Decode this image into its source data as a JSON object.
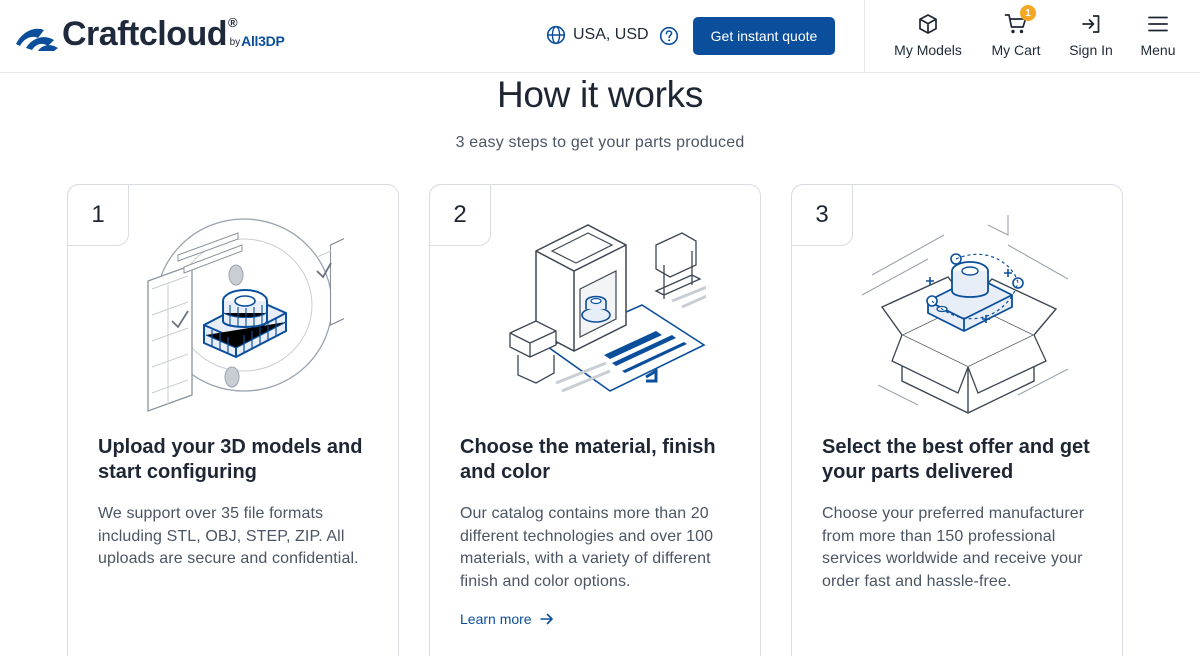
{
  "header": {
    "logo": {
      "name": "Craftcloud",
      "registered": "®",
      "by": "by",
      "partner": "All3DP"
    },
    "locale": {
      "label": "USA, USD",
      "icon": "globe-icon"
    },
    "help_icon": "question-circle-icon",
    "quote_button": "Get instant quote",
    "nav": [
      {
        "label": "My Models",
        "icon": "cube-icon"
      },
      {
        "label": "My Cart",
        "icon": "cart-icon",
        "badge": "1"
      },
      {
        "label": "Sign In",
        "icon": "sign-in-icon"
      },
      {
        "label": "Menu",
        "icon": "hamburger-menu-icon"
      }
    ]
  },
  "hero": {
    "title": "How it works",
    "subtitle": "3 easy steps to get your parts produced"
  },
  "steps": [
    {
      "number": "1",
      "title": "Upload your 3D models and start configuring",
      "text": "We support over 35 file formats including STL, OBJ, STEP, ZIP. All uploads are secure and confidential.",
      "illustration": "upload-model-illustration"
    },
    {
      "number": "2",
      "title": "Choose the material, finish and color",
      "text": "Our catalog contains more than 20 different technologies and over 100 materials, with a variety of different finish and color options.",
      "link": "Learn more",
      "illustration": "printer-material-illustration"
    },
    {
      "number": "3",
      "title": "Select the best offer and get your parts delivered",
      "text": "Choose your preferred manufacturer from more than 150 professional services worldwide and receive your order fast and hassle-free.",
      "illustration": "delivery-box-illustration"
    }
  ],
  "colors": {
    "brand_blue": "#0b4f9c",
    "text_dark": "#1e2633",
    "text_muted": "#4b5563",
    "border": "#d9dce1",
    "badge": "#f5a623"
  }
}
